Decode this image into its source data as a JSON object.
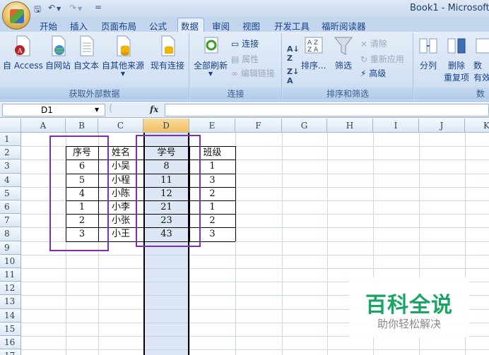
{
  "window": {
    "title": "Book1 - Microsoft I"
  },
  "quick_access": {
    "save_icon": "save-icon",
    "undo_icon": "undo-icon",
    "redo_icon": "redo-icon",
    "customize_glyph": "="
  },
  "tabs": [
    {
      "label": "开始"
    },
    {
      "label": "插入"
    },
    {
      "label": "页面布局"
    },
    {
      "label": "公式"
    },
    {
      "label": "数据",
      "active": true
    },
    {
      "label": "审阅"
    },
    {
      "label": "视图"
    },
    {
      "label": "开发工具"
    },
    {
      "label": "福昕阅读器"
    }
  ],
  "ribbon": {
    "get_external": {
      "label": "获取外部数据",
      "buttons": [
        {
          "label": "自 Access"
        },
        {
          "label": "自网站"
        },
        {
          "label": "自文本"
        },
        {
          "label": "自其他来源"
        },
        {
          "label": "现有连接"
        }
      ]
    },
    "connections": {
      "label": "连接",
      "refresh_all": "全部刷新",
      "connections": "连接",
      "properties": "属性",
      "edit_links": "编辑链接"
    },
    "sort_filter": {
      "label": "排序和筛选",
      "sort": "排序...",
      "filter": "筛选",
      "clear": "清除",
      "reapply": "重新应用",
      "advanced": "高级"
    },
    "data_tools": {
      "label": "数",
      "text_to_columns": "分列",
      "remove_dup_line1": "删除",
      "remove_dup_line2": "重复项",
      "validation_line1": "数",
      "validation_line2": "有效"
    }
  },
  "formula_bar": {
    "name_box": "D1",
    "fx": "fx",
    "content": ""
  },
  "sheet": {
    "columns": [
      "A",
      "B",
      "C",
      "D",
      "E",
      "F",
      "G",
      "H",
      "I",
      "J",
      "K"
    ],
    "selected_column": "D",
    "rows": [
      "1",
      "2",
      "3",
      "4",
      "5",
      "6",
      "7",
      "8",
      "9",
      "10",
      "11",
      "12",
      "13",
      "14",
      "15",
      "16",
      "17"
    ],
    "table": {
      "headers": [
        "序号",
        "姓名",
        "学号",
        "班级"
      ],
      "rows": [
        [
          "6",
          "小吴",
          "8",
          "1"
        ],
        [
          "5",
          "小程",
          "11",
          "3"
        ],
        [
          "4",
          "小陈",
          "12",
          "2"
        ],
        [
          "1",
          "小李",
          "21",
          "1"
        ],
        [
          "2",
          "小张",
          "23",
          "2"
        ],
        [
          "3",
          "小王",
          "43",
          "3"
        ]
      ]
    },
    "highlight_color": "#7b2fb5"
  },
  "watermark": {
    "title": "百科全说",
    "subtitle": "助你轻松解决"
  }
}
